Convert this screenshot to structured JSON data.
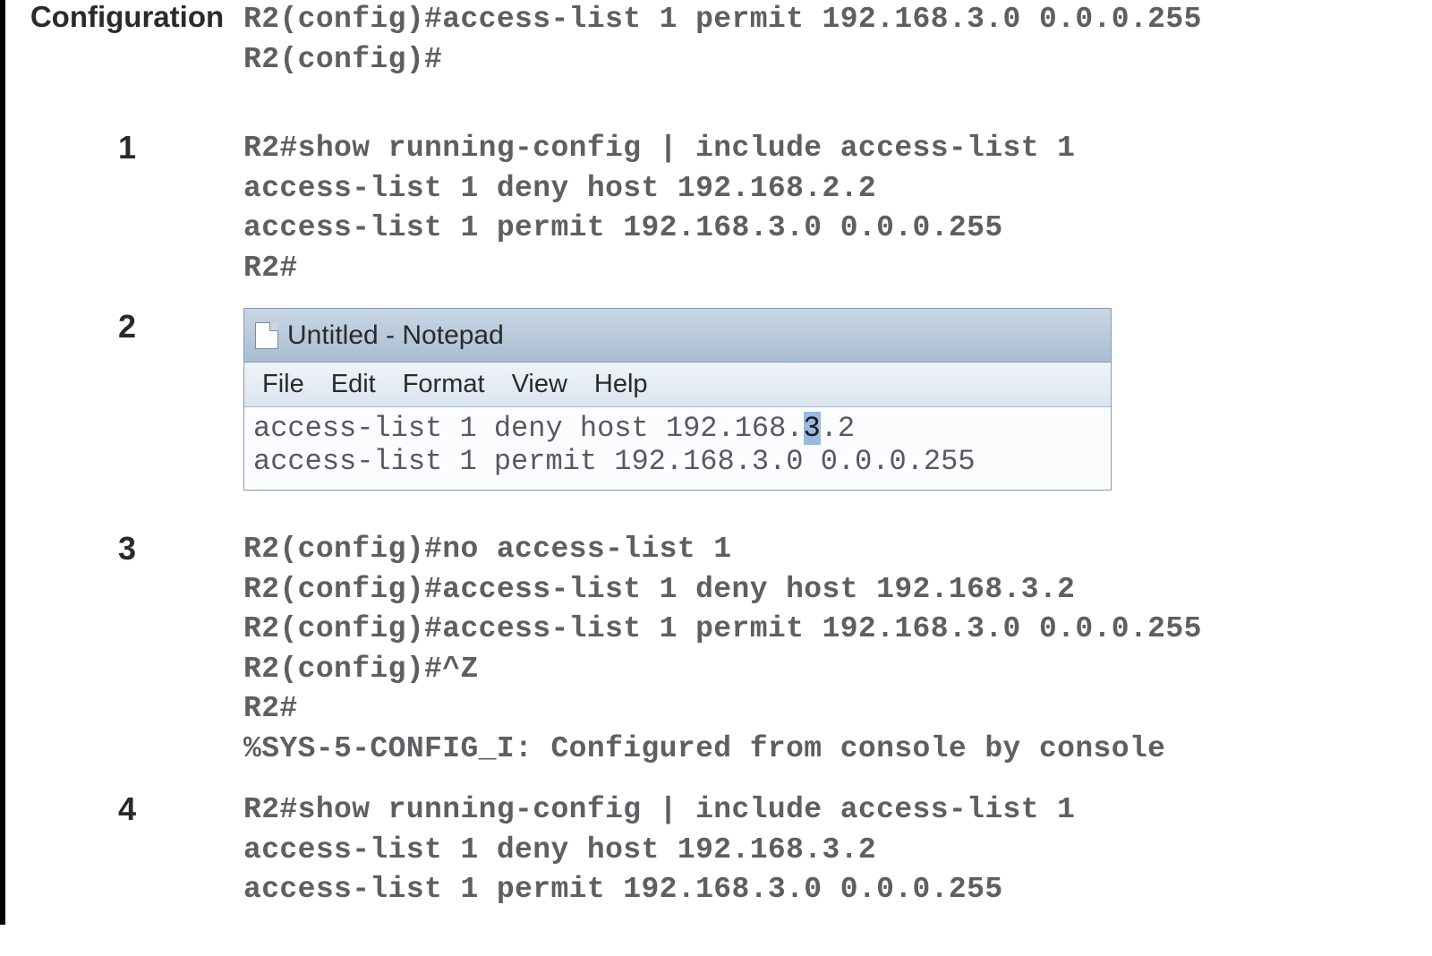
{
  "labels": {
    "configuration": "Configuration",
    "step1": "1",
    "step2": "2",
    "step3": "3",
    "step4": "4"
  },
  "configuration": {
    "line1": "R2(config)#access-list 1 permit 192.168.3.0 0.0.0.255",
    "line2": "R2(config)#"
  },
  "step1": {
    "line1": "R2#show running-config | include access-list 1",
    "line2": "access-list 1 deny host 192.168.2.2",
    "line3": "access-list 1 permit 192.168.3.0 0.0.0.255",
    "line4": "R2#"
  },
  "notepad": {
    "title": "Untitled - Notepad",
    "menu": {
      "file": "File",
      "edit": "Edit",
      "format": "Format",
      "view": "View",
      "help": "Help"
    },
    "body": {
      "line1_pre": "access-list 1 deny host 192.168.",
      "line1_sel": "3",
      "line1_post": ".2",
      "line2": "access-list 1 permit 192.168.3.0 0.0.0.255"
    }
  },
  "step3": {
    "line1": "R2(config)#no access-list 1",
    "line2": "R2(config)#access-list 1 deny host 192.168.3.2",
    "line3": "R2(config)#access-list 1 permit 192.168.3.0 0.0.0.255",
    "line4": "R2(config)#^Z",
    "line5": "R2#",
    "line6": "%SYS-5-CONFIG_I: Configured from console by console"
  },
  "step4": {
    "line1": "R2#show running-config | include access-list 1",
    "line2": "access-list 1 deny host 192.168.3.2",
    "line3": "access-list 1 permit 192.168.3.0 0.0.0.255"
  }
}
